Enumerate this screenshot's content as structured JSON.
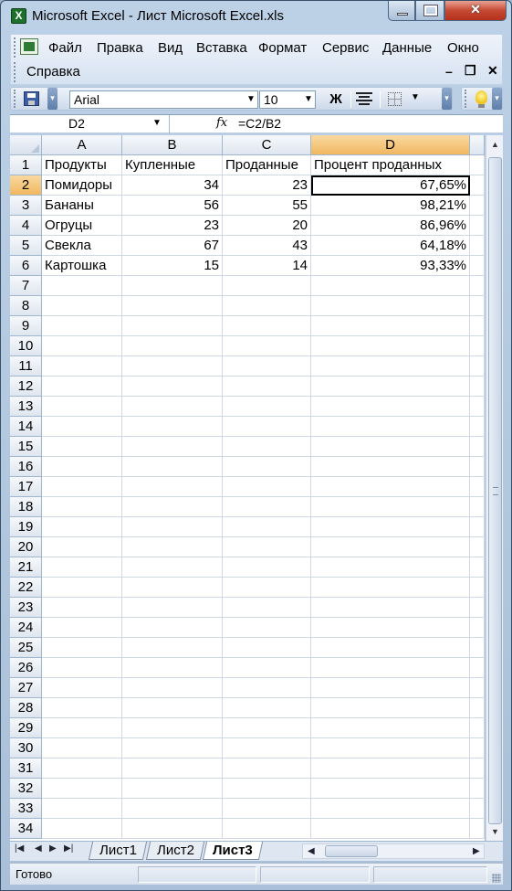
{
  "window": {
    "title": "Microsoft Excel - Лист Microsoft Excel.xls",
    "app_icon": "excel-icon",
    "close_glyph": "✕"
  },
  "menu": {
    "items": [
      "Файл",
      "Правка",
      "Вид",
      "Вставка",
      "Формат",
      "Сервис",
      "Данные",
      "Окно",
      "Справка"
    ],
    "mdi_min": "–",
    "mdi_restore": "❐",
    "mdi_close": "✕"
  },
  "toolbar": {
    "font_name": "Arial",
    "font_size": "10",
    "bold_label": "Ж"
  },
  "formula_bar": {
    "name_box": "D2",
    "fx_label": "fx",
    "formula": "=C2/B2"
  },
  "grid": {
    "columns": [
      "A",
      "B",
      "C",
      "D"
    ],
    "rows": [
      "1",
      "2",
      "3",
      "4",
      "5",
      "6",
      "7",
      "8",
      "9",
      "10",
      "11",
      "12",
      "13",
      "14",
      "15",
      "16",
      "17",
      "18",
      "19",
      "20",
      "21",
      "22",
      "23",
      "24",
      "25",
      "26",
      "27",
      "28",
      "29",
      "30",
      "31",
      "32",
      "33",
      "34"
    ],
    "selected_cell": "D2",
    "cells": [
      [
        "Продукты",
        "Купленные",
        "Проданные",
        "Процент проданных"
      ],
      [
        "Помидоры",
        "34",
        "23",
        "67,65%"
      ],
      [
        "Бананы",
        "56",
        "55",
        "98,21%"
      ],
      [
        "Огруцы",
        "23",
        "20",
        "86,96%"
      ],
      [
        "Свекла",
        "67",
        "43",
        "64,18%"
      ],
      [
        "Картошка",
        "15",
        "14",
        "93,33%"
      ]
    ]
  },
  "sheets": {
    "tabs": [
      "Лист1",
      "Лист2",
      "Лист3"
    ],
    "active": "Лист3"
  },
  "status": {
    "text": "Готово"
  },
  "colors": {
    "selected_header": "#f1b760",
    "gridline": "#d0d7e5",
    "title_close": "#c64a33"
  }
}
